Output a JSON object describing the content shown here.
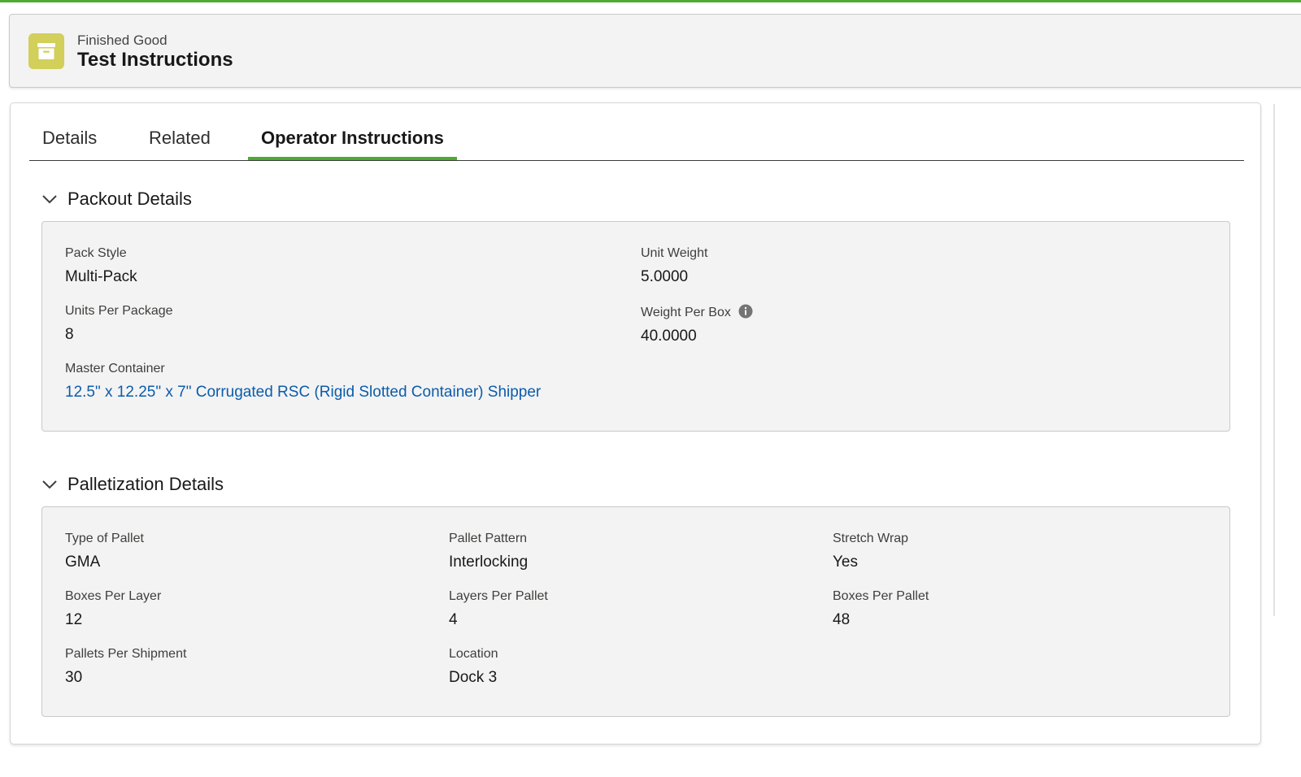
{
  "colors": {
    "accent": "#4bac2f",
    "link": "#0b5cab",
    "icon_bg": "#d2cf5a"
  },
  "header": {
    "icon": "archive-box-icon",
    "subtitle": "Finished Good",
    "title": "Test Instructions"
  },
  "tabs": [
    {
      "label": "Details",
      "active": false
    },
    {
      "label": "Related",
      "active": false
    },
    {
      "label": "Operator Instructions",
      "active": true
    }
  ],
  "packout": {
    "title": "Packout Details",
    "fields": {
      "pack_style": {
        "label": "Pack Style",
        "value": "Multi-Pack"
      },
      "unit_weight": {
        "label": "Unit Weight",
        "value": "5.0000"
      },
      "units_per_package": {
        "label": "Units Per Package",
        "value": "8"
      },
      "weight_per_box": {
        "label": "Weight Per Box",
        "value": "40.0000",
        "help_icon": "info-icon"
      },
      "master_container": {
        "label": "Master Container",
        "value": "12.5\" x 12.25\" x 7\" Corrugated RSC (Rigid Slotted Container) Shipper"
      }
    }
  },
  "palletization": {
    "title": "Palletization Details",
    "fields": {
      "type_of_pallet": {
        "label": "Type of Pallet",
        "value": "GMA"
      },
      "pallet_pattern": {
        "label": "Pallet Pattern",
        "value": "Interlocking"
      },
      "stretch_wrap": {
        "label": "Stretch Wrap",
        "value": "Yes"
      },
      "boxes_per_layer": {
        "label": "Boxes Per Layer",
        "value": "12"
      },
      "layers_per_pallet": {
        "label": "Layers Per Pallet",
        "value": "4"
      },
      "boxes_per_pallet": {
        "label": "Boxes Per Pallet",
        "value": "48"
      },
      "pallets_per_shipment": {
        "label": "Pallets Per Shipment",
        "value": "30"
      },
      "location": {
        "label": "Location",
        "value": "Dock 3"
      }
    }
  }
}
